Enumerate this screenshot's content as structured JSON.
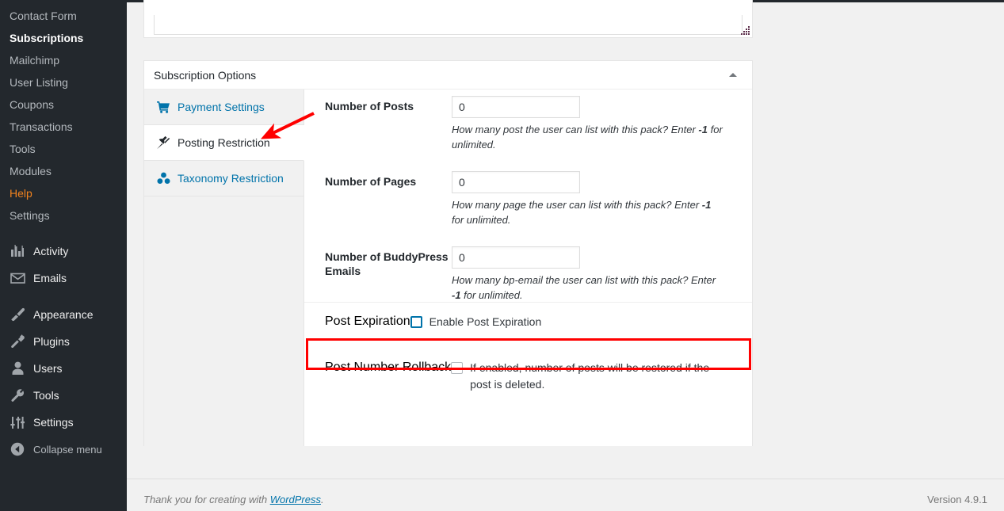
{
  "sidebar": {
    "submenu": [
      {
        "label": "Contact Form",
        "state": "normal"
      },
      {
        "label": "Subscriptions",
        "state": "current"
      },
      {
        "label": "Mailchimp",
        "state": "normal"
      },
      {
        "label": "User Listing",
        "state": "normal"
      },
      {
        "label": "Coupons",
        "state": "normal"
      },
      {
        "label": "Transactions",
        "state": "normal"
      },
      {
        "label": "Tools",
        "state": "normal"
      },
      {
        "label": "Modules",
        "state": "normal"
      },
      {
        "label": "Help",
        "state": "help"
      },
      {
        "label": "Settings",
        "state": "normal"
      }
    ],
    "menu": [
      {
        "label": "Activity",
        "icon": "activity-chart-icon"
      },
      {
        "label": "Emails",
        "icon": "envelope-icon"
      },
      {
        "label": "Appearance",
        "icon": "paintbrush-icon"
      },
      {
        "label": "Plugins",
        "icon": "plug-icon"
      },
      {
        "label": "Users",
        "icon": "user-icon"
      },
      {
        "label": "Tools",
        "icon": "wrench-icon"
      },
      {
        "label": "Settings",
        "icon": "sliders-icon"
      }
    ],
    "collapse_label": "Collapse menu",
    "collapse_icon": "circle-left-arrow-icon"
  },
  "postbox": {
    "title": "Subscription Options",
    "toggle_icon": "triangle-up-icon",
    "tabs": [
      {
        "label": "Payment Settings",
        "icon": "shopping-cart-icon",
        "active": false
      },
      {
        "label": "Posting Restriction",
        "icon": "pushpin-icon",
        "active": true
      },
      {
        "label": "Taxonomy Restriction",
        "icon": "taxonomy-dots-icon",
        "active": false
      }
    ],
    "fields": {
      "posts": {
        "label": "Number of Posts",
        "value": "0",
        "desc_pre": "How many post the user can list with this pack? Enter ",
        "desc_bold": "-1",
        "desc_post": " for unlimited."
      },
      "pages": {
        "label": "Number of Pages",
        "value": "0",
        "desc_pre": "How many page the user can list with this pack? Enter ",
        "desc_bold": "-1",
        "desc_post": " for unlimited."
      },
      "bp_emails": {
        "label": "Number of BuddyPress Emails",
        "value": "0",
        "desc_pre": "How many bp-email the user can list with this pack? Enter ",
        "desc_bold": "-1",
        "desc_post": " for unlimited."
      },
      "post_expiration": {
        "label": "Post Expiration",
        "checkbox_label": "Enable Post Expiration",
        "checked": false,
        "focused": true
      },
      "post_number_rollback": {
        "label": "Post Number Rollback",
        "checkbox_label": "If enabled, number of posts will be restored if the post is deleted.",
        "checked": false,
        "focused": false
      }
    }
  },
  "annotations": {
    "highlight_color": "#ff0000",
    "arrow_color": "#ff0000",
    "arrow_target": "Posting Restriction",
    "highlight_target": "Post Expiration"
  },
  "footer": {
    "thanks_pre": "Thank you for creating with ",
    "link_label": "WordPress",
    "thanks_post": ".",
    "version": "Version 4.9.1"
  }
}
